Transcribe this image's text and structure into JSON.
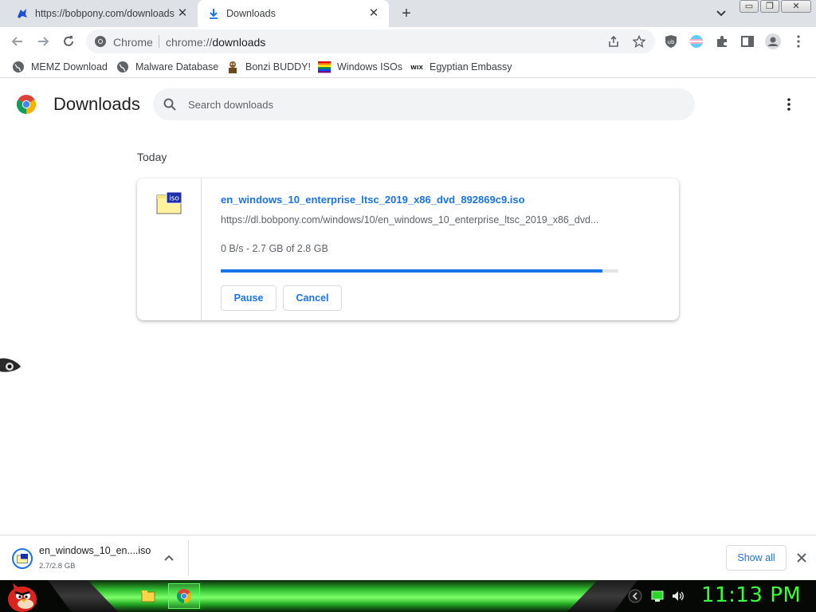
{
  "tabs": [
    {
      "title": "https://bobpony.com/downloads",
      "icon": "bobpony-favicon",
      "active": false
    },
    {
      "title": "Downloads",
      "icon": "download-icon",
      "active": true
    }
  ],
  "window_controls": {
    "minimize": "▭",
    "restore": "❐",
    "close": "✕"
  },
  "toolbar": {
    "site_name": "Chrome",
    "url_scheme": "chrome://",
    "url_host": "downloads"
  },
  "bookmarks": [
    {
      "label": "MEMZ Download",
      "icon": "globe-icon"
    },
    {
      "label": "Malware Database",
      "icon": "globe-icon"
    },
    {
      "label": "Bonzi BUDDY!",
      "icon": "bonzi-icon"
    },
    {
      "label": "Windows ISOs",
      "icon": "windows-flag-icon"
    },
    {
      "label": "Egyptian Embassy",
      "icon": "wix-icon"
    }
  ],
  "downloads_page": {
    "title": "Downloads",
    "search_placeholder": "Search downloads",
    "date_header": "Today"
  },
  "download_item": {
    "file_name": "en_windows_10_enterprise_ltsc_2019_x86_dvd_892869c9.iso",
    "url": "https://dl.bobpony.com/windows/10/en_windows_10_enterprise_ltsc_2019_x86_dvd...",
    "status": "0 B/s - 2.7 GB of 2.8 GB",
    "progress_fraction": 0.96,
    "pause_label": "Pause",
    "cancel_label": "Cancel",
    "icon_text": "iso"
  },
  "shelf": {
    "file_name": "en_windows_10_en....iso",
    "size": "2.7/2.8 GB",
    "show_all_label": "Show all"
  },
  "taskbar": {
    "clock": "11:13 PM"
  },
  "colors": {
    "accent": "#1a73e8",
    "taskbar_green": "#39ff39"
  }
}
